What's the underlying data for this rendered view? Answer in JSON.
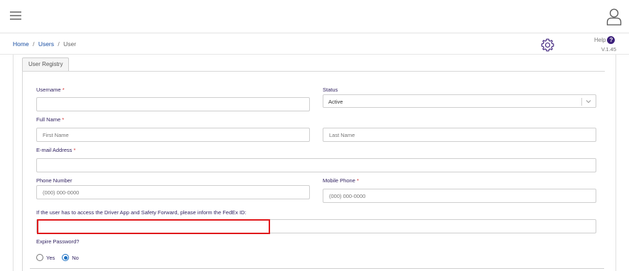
{
  "header": {
    "menu_icon": "hamburger-icon",
    "user_icon": "user-icon"
  },
  "breadcrumb": {
    "items": [
      "Home",
      "Users",
      "User"
    ],
    "separator": "/"
  },
  "toolbar": {
    "settings_icon": "gear-icon",
    "help_label": "Help",
    "help_glyph": "?",
    "version": "V.1.45"
  },
  "tabs": [
    {
      "label": "User Registry",
      "active": true
    }
  ],
  "form": {
    "username": {
      "label": "Username",
      "required_mark": "*",
      "value": ""
    },
    "status": {
      "label": "Status",
      "selected": "Active"
    },
    "full_name": {
      "label": "Full Name",
      "required_mark": "*",
      "first_placeholder": "First Name",
      "last_placeholder": "Last Name"
    },
    "email": {
      "label": "E-mail Address",
      "required_mark": "*",
      "value": ""
    },
    "phone": {
      "label": "Phone Number",
      "placeholder": "(000) 000-0000"
    },
    "mobile": {
      "label": "Mobile Phone",
      "required_mark": "*",
      "placeholder": "(000) 000-0000"
    },
    "fedex": {
      "label": "If the user has to access the Driver App and Safety Forward, please inform the FedEx ID:",
      "value": ""
    },
    "expire_password": {
      "label": "Expire Password?",
      "options": [
        {
          "label": "Yes",
          "checked": false
        },
        {
          "label": "No",
          "checked": true
        }
      ]
    }
  },
  "colors": {
    "accent": "#1a6fc2",
    "label": "#2e1f5e",
    "required": "#d32f2f",
    "highlight": "#e0191c",
    "link": "#1a4fa3"
  }
}
